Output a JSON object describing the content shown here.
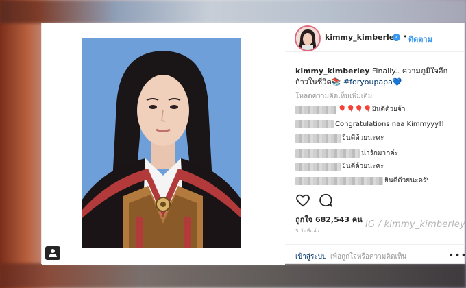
{
  "profile": {
    "username": "kimmy_kimberley",
    "verified_glyph": "✓",
    "separator": "•",
    "follow_label": "ติดตาม"
  },
  "caption": {
    "username": "kimmy_kimberley",
    "text": " Finally.. ความภูมิใจอีกก้าวในชีวิต",
    "emoji": "📚",
    "hashtag": " #foryoupapa",
    "heart": "💙"
  },
  "load_more": "โหลดความคิดเห็นเพิ่มเติม",
  "comments": [
    {
      "text": "🎈🎈🎈🎈ยินดีด้วยจ้า"
    },
    {
      "text": "Congratulations naa Kimmyyy!!"
    },
    {
      "text": "ยินดีด้วยนะคะ"
    },
    {
      "text": "น่ารักมากค่ะ"
    },
    {
      "text": "ยินดีด้วยนะคะ"
    },
    {
      "text": "ยินดีด้วยนะครับ"
    }
  ],
  "icons": {
    "heart": "heart-icon",
    "comment": "comment-icon",
    "user_tag": "user-tag-icon",
    "verified": "verified-badge-icon",
    "more": "more-options-icon"
  },
  "likes": "ถูกใจ 682,543 คน",
  "time": "3 วันที่แล้ว",
  "watermark": "IG / kimmy_kimberley",
  "footer": {
    "login": "เข้าสู่ระบบ",
    "rest": "เพื่อถูกใจหรือความคิดเห็น",
    "more": "•••"
  },
  "colors": {
    "accent": "#3897f0",
    "text": "#262626",
    "muted": "#999999",
    "photo_bg": "#6f9fd9"
  }
}
